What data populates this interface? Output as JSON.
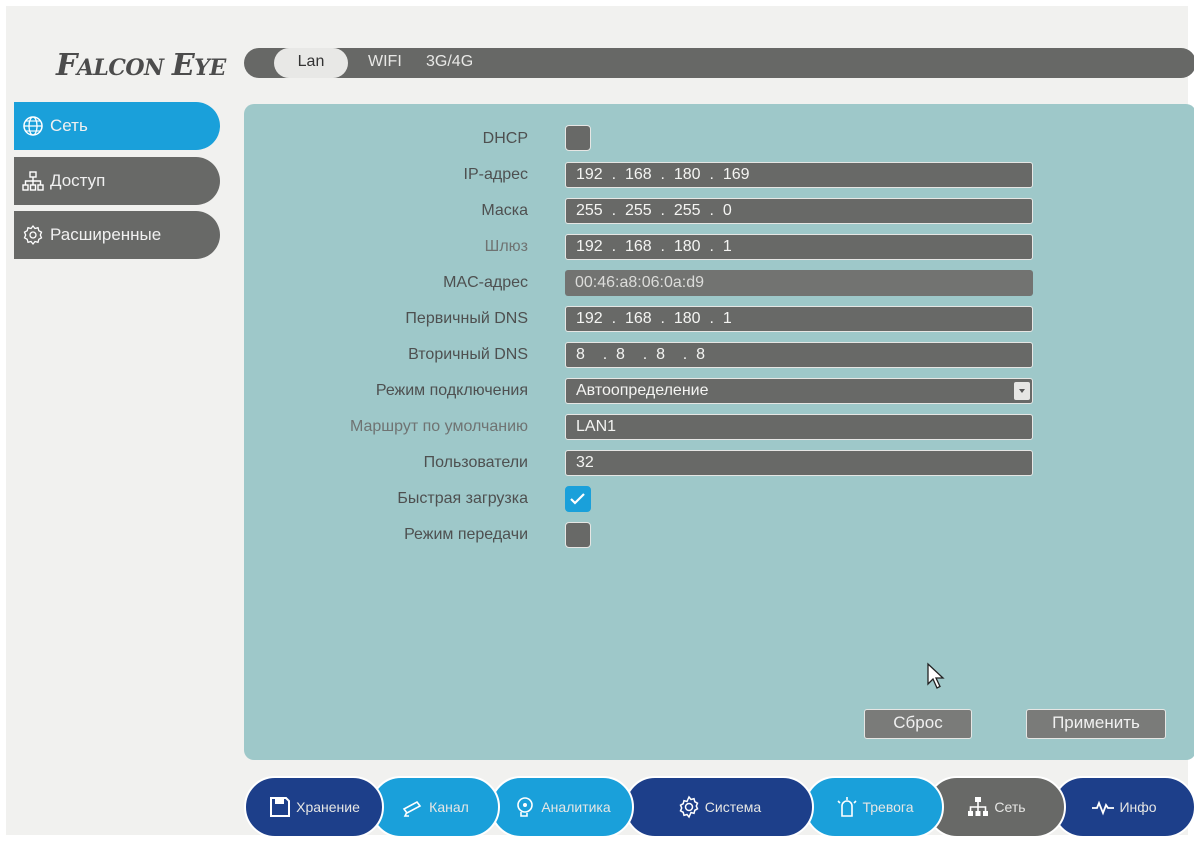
{
  "brand": {
    "logo_text": "Falcon Eye"
  },
  "top_tabs": [
    "Lan",
    "WIFI",
    "3G/4G"
  ],
  "side_tabs": [
    {
      "label": "Сеть",
      "icon": "globe-icon",
      "active": true
    },
    {
      "label": "Доступ",
      "icon": "network-icon",
      "active": false
    },
    {
      "label": "Расширенные",
      "icon": "gear-icon",
      "active": false
    }
  ],
  "form": {
    "dhcp": {
      "label": "DHCP",
      "checked": false
    },
    "ip": {
      "label": "IP-адрес",
      "segments": [
        "192",
        "168",
        "180",
        "169"
      ]
    },
    "mask": {
      "label": "Маска",
      "segments": [
        "255",
        "255",
        "255",
        "0"
      ]
    },
    "gateway": {
      "label": "Шлюз",
      "segments": [
        "192",
        "168",
        "180",
        "1"
      ]
    },
    "mac": {
      "label": "MAC-адрес",
      "value": "00:46:a8:06:0a:d9"
    },
    "dns1": {
      "label": "Первичный DNS",
      "segments": [
        "192",
        "168",
        "180",
        "1"
      ]
    },
    "dns2": {
      "label": "Вторичный DNS",
      "segments": [
        "8",
        "8",
        "8",
        "8"
      ]
    },
    "conn_mode": {
      "label": "Режим подключения",
      "value": "Автоопределение"
    },
    "default_route": {
      "label": "Маршрут по умолчанию",
      "value": "LAN1"
    },
    "users": {
      "label": "Пользователи",
      "value": "32"
    },
    "fast_load": {
      "label": "Быстрая загрузка",
      "checked": true
    },
    "transfer_mode": {
      "label": "Режим передачи",
      "checked": false
    }
  },
  "buttons": {
    "reset": "Сброс",
    "apply": "Применить"
  },
  "bottom_nav": [
    {
      "label": "Хранение",
      "icon": "floppy-disk-icon",
      "color": "#1d3f8a"
    },
    {
      "label": "Канал",
      "icon": "camera-icon",
      "color": "#1aa0da"
    },
    {
      "label": "Аналитика",
      "icon": "brain-icon",
      "color": "#1aa0da"
    },
    {
      "label": "Система",
      "icon": "gear-icon",
      "color": "#1d3f8a"
    },
    {
      "label": "Тревога",
      "icon": "alarm-light-icon",
      "color": "#1aa0da"
    },
    {
      "label": "Сеть",
      "icon": "network-icon",
      "color": "#686967"
    },
    {
      "label": "Инфо",
      "icon": "pulse-icon",
      "color": "#1d3f8a"
    }
  ],
  "colors": {
    "accent": "#1aa0da",
    "panel": "#9ec8c9",
    "dark": "#686967",
    "nav_blue": "#1d3f8a"
  }
}
